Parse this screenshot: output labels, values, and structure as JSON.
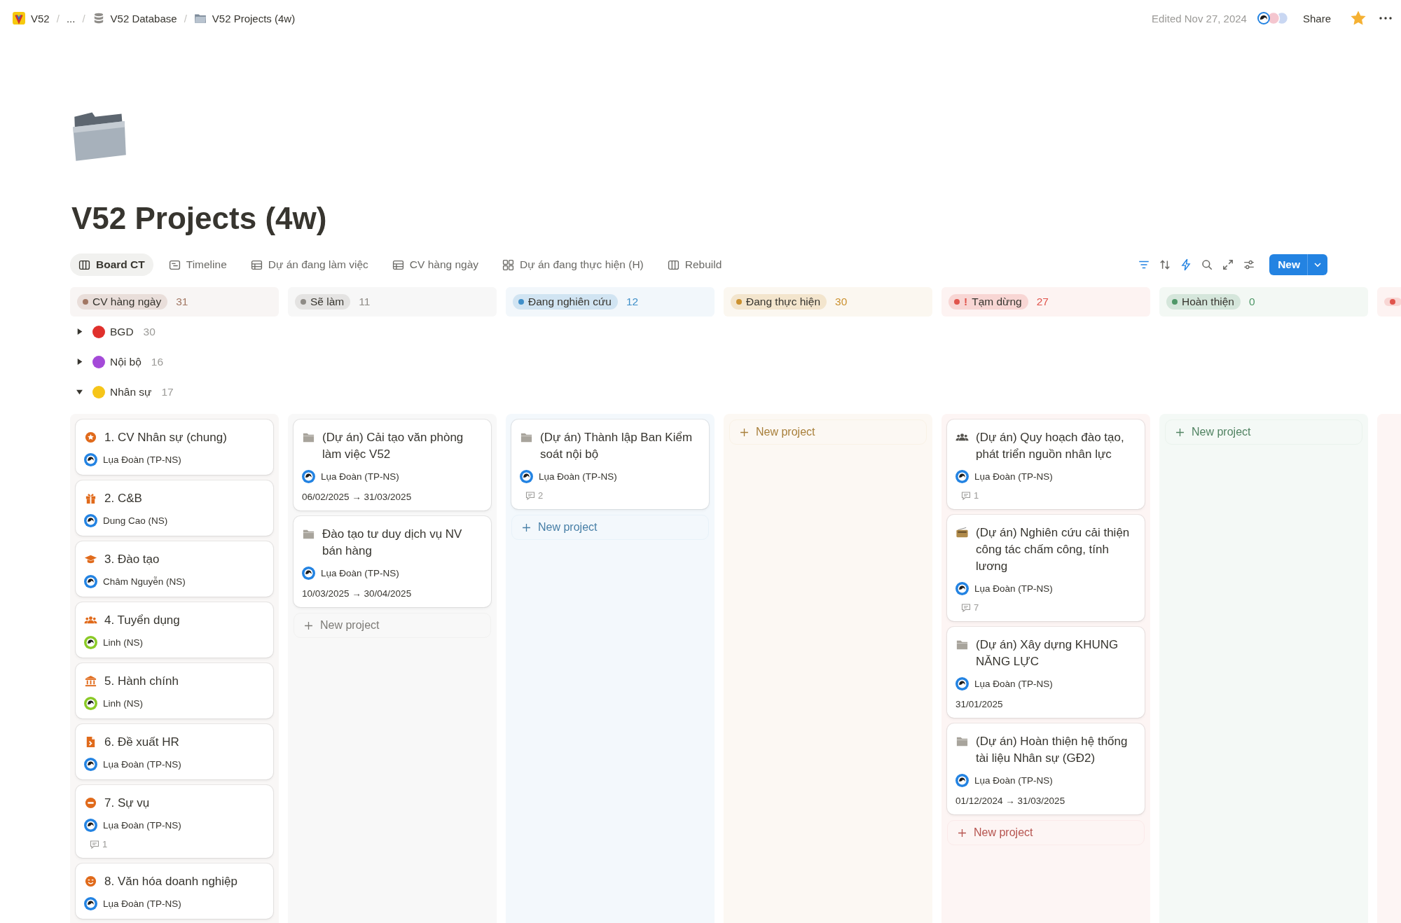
{
  "breadcrumb": [
    {
      "kind": "logo",
      "label": "V52"
    },
    {
      "kind": "more",
      "separator": "/",
      "label": "..."
    },
    {
      "kind": "database",
      "separator": "/",
      "label": "V52 Database"
    },
    {
      "kind": "folder",
      "separator": "/",
      "label": "V52 Projects (4w)"
    }
  ],
  "edited": "Edited Nov 27, 2024",
  "share": "Share",
  "favorite": true,
  "title": "V52 Projects (4w)",
  "views": [
    {
      "kind": "board",
      "label": "Board CT",
      "selected": true
    },
    {
      "kind": "timeline",
      "label": "Timeline",
      "selected": false
    },
    {
      "kind": "table",
      "label": "Dự án đang làm việc",
      "selected": false
    },
    {
      "kind": "table",
      "label": "CV hàng ngày",
      "selected": false
    },
    {
      "kind": "gallery",
      "label": "Dự án đang thực hiện (H)",
      "selected": false
    },
    {
      "kind": "board",
      "label": "Rebuild",
      "selected": false
    }
  ],
  "new_button": "New",
  "columns": [
    {
      "label": "CV hàng ngày",
      "count": "31",
      "color": "#a27763"
    },
    {
      "label": "Sẽ làm",
      "count": "11",
      "color": "#8e8b86"
    },
    {
      "label": "Đang nghiên cứu",
      "count": "12",
      "color": "#3f8fc9"
    },
    {
      "label": "Đang thực hiện",
      "count": "30",
      "color": "#cb912f"
    },
    {
      "prefix": "!",
      "label": "Tạm dừng",
      "count": "27",
      "color": "#e0544c"
    },
    {
      "label": "Hoàn thiện",
      "count": "0",
      "color": "#4f9768"
    },
    {
      "color": "#e0544c"
    }
  ],
  "groups": [
    {
      "label": "BGD",
      "count": "30",
      "color": "#e0302c",
      "expanded": false
    },
    {
      "label": "Nội bộ",
      "count": "16",
      "color": "#a44ad8",
      "expanded": false
    },
    {
      "label": "Nhân sự",
      "count": "17",
      "color": "#f6c519",
      "expanded": true,
      "lanes": [
        {
          "cards": [
            {
              "kind": "star",
              "color": "#e06a1b",
              "title": "1. CV Nhân sự (chung)",
              "person": {
                "name": "Lụa Đoàn (TP-NS)",
                "color": "#2383e2"
              }
            },
            {
              "kind": "gift",
              "color": "#e06a1b",
              "title": "2. C&B",
              "person": {
                "name": "Dung Cao (NS)",
                "color": "#2383e2"
              }
            },
            {
              "kind": "cap",
              "color": "#e06a1b",
              "title": "3. Đào tạo",
              "person": {
                "name": "Châm Nguyễn (NS)",
                "color": "#2383e2"
              }
            },
            {
              "kind": "people",
              "color": "#e06a1b",
              "title": "4. Tuyển dụng",
              "person": {
                "name": "Linh (NS)",
                "color": "#8ac926"
              }
            },
            {
              "kind": "bank",
              "color": "#e06a1b",
              "title": "5. Hành chính",
              "person": {
                "name": "Linh (NS)",
                "color": "#8ac926"
              }
            },
            {
              "kind": "document",
              "color": "#e06a1b",
              "title": "6. Đề xuất HR",
              "person": {
                "name": "Lụa Đoàn (TP-NS)",
                "color": "#2383e2"
              }
            },
            {
              "kind": "no-entry",
              "color": "#e06a1b",
              "title": "7. Sự vụ",
              "person": {
                "name": "Lụa Đoàn (TP-NS)",
                "color": "#2383e2"
              },
              "comments": "1"
            },
            {
              "kind": "smile",
              "color": "#e06a1b",
              "title": "8. Văn hóa doanh nghiệp",
              "person": {
                "name": "Lụa Đoàn (TP-NS)",
                "color": "#2383e2"
              }
            }
          ]
        },
        {
          "cards": [
            {
              "kind": "folder",
              "color": "#a8a49c",
              "title": "(Dự án) Cải tạo văn phòng làm việc V52",
              "person": {
                "name": "Lụa Đoàn (TP-NS)",
                "color": "#2383e2"
              },
              "date": "06/02/2025 → 31/03/2025"
            },
            {
              "kind": "folder",
              "color": "#a8a49c",
              "title": "Đào tạo tư duy dịch vụ NV bán hàng",
              "person": {
                "name": "Lụa Đoàn (TP-NS)",
                "color": "#2383e2"
              },
              "date": "10/03/2025 → 30/04/2025"
            }
          ],
          "add_label": "New project"
        },
        {
          "cards": [
            {
              "kind": "folder",
              "color": "#a8a49c",
              "title": "(Dự án) Thành lập Ban Kiểm soát nội bộ",
              "person": {
                "name": "Lụa Đoàn (TP-NS)",
                "color": "#2383e2"
              },
              "comments": "2"
            }
          ],
          "add_label": "New project"
        },
        {
          "add_label": "New project"
        },
        {
          "cards": [
            {
              "kind": "people",
              "color": "#55534e",
              "title": "(Dự án) Quy hoạch đào tạo, phát triển nguồn nhân lực",
              "person": {
                "name": "Lụa Đoàn (TP-NS)",
                "color": "#2383e2"
              },
              "comments": "1"
            },
            {
              "kind": "radio",
              "color": "#b08a4a",
              "title": "(Dự án) Nghiên cứu cải thiện công tác chấm công, tính lương",
              "person": {
                "name": "Lụa Đoàn (TP-NS)",
                "color": "#2383e2"
              },
              "comments": "7"
            },
            {
              "kind": "folder",
              "color": "#a8a49c",
              "title": "(Dự án) Xây dựng KHUNG NĂNG LỰC",
              "person": {
                "name": "Lụa Đoàn (TP-NS)",
                "color": "#2383e2"
              },
              "date": "31/01/2025"
            },
            {
              "kind": "folder",
              "color": "#a8a49c",
              "title": "(Dự án) Hoàn thiện hệ thống tài liệu Nhân sự (GĐ2)",
              "person": {
                "name": "Lụa Đoàn (TP-NS)",
                "color": "#2383e2"
              },
              "date": "01/12/2024 → 31/03/2025"
            }
          ],
          "add_label": "New project"
        },
        {
          "add_label": "New project"
        }
      ]
    }
  ]
}
